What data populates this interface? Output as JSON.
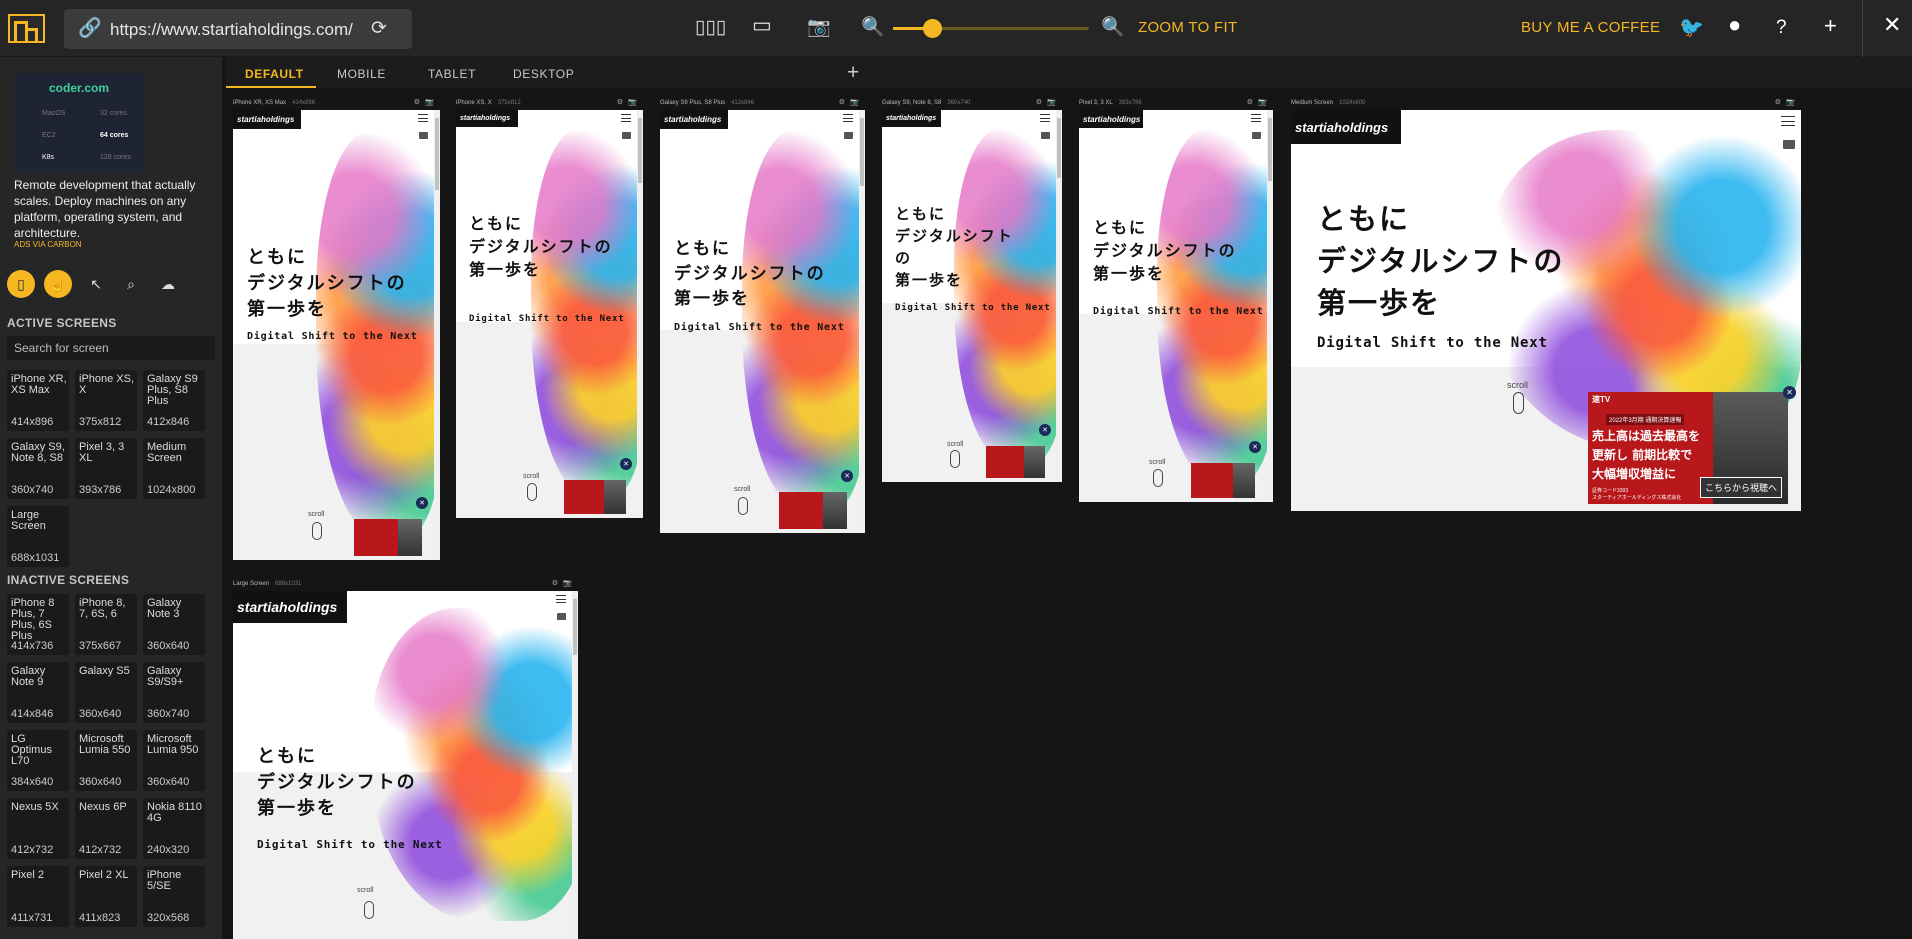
{
  "toolbar": {
    "url": "https://www.startiaholdings.com/",
    "zoom_to_fit": "ZOOM TO FIT",
    "buy_coffee": "BUY ME A COFFEE",
    "zoom_level": 0.2,
    "accent": "#f5b822"
  },
  "sidebar": {
    "ad": {
      "brand": "coder.com",
      "cells": [
        "MacOS",
        "32 cores",
        "EC2",
        "64 cores",
        "K8s",
        "128 cores"
      ],
      "text": "Remote development that actually scales. Deploy machines on any platform, operating system, and architecture.",
      "via": "ADS VIA CARBON"
    },
    "active_title": "ACTIVE SCREENS",
    "search_placeholder": "Search for screen",
    "active_screens": [
      {
        "name": "iPhone XR, XS Max",
        "size": "414x896"
      },
      {
        "name": "iPhone XS, X",
        "size": "375x812"
      },
      {
        "name": "Galaxy S9 Plus, S8 Plus",
        "size": "412x846"
      },
      {
        "name": "Galaxy S9, Note 8, S8",
        "size": "360x740"
      },
      {
        "name": "Pixel 3, 3 XL",
        "size": "393x786"
      },
      {
        "name": "Medium Screen",
        "size": "1024x800"
      },
      {
        "name": "Large Screen",
        "size": "688x1031"
      }
    ],
    "inactive_title": "INACTIVE SCREENS",
    "inactive_screens": [
      {
        "name": "iPhone 8 Plus, 7 Plus, 6S Plus",
        "size": "414x736"
      },
      {
        "name": "iPhone 8, 7, 6S, 6",
        "size": "375x667"
      },
      {
        "name": "Galaxy Note 3",
        "size": "360x640"
      },
      {
        "name": "Galaxy Note 9",
        "size": "414x846"
      },
      {
        "name": "Galaxy S5",
        "size": "360x640"
      },
      {
        "name": "Galaxy S9/S9+",
        "size": "360x740"
      },
      {
        "name": "LG Optimus L70",
        "size": "384x640"
      },
      {
        "name": "Microsoft Lumia 550",
        "size": "360x640"
      },
      {
        "name": "Microsoft Lumia 950",
        "size": "360x640"
      },
      {
        "name": "Nexus 5X",
        "size": "412x732"
      },
      {
        "name": "Nexus 6P",
        "size": "412x732"
      },
      {
        "name": "Nokia 8110 4G",
        "size": "240x320"
      },
      {
        "name": "Pixel 2",
        "size": "411x731"
      },
      {
        "name": "Pixel 2 XL",
        "size": "411x823"
      },
      {
        "name": "iPhone 5/SE",
        "size": "320x568"
      }
    ]
  },
  "tabs": [
    "DEFAULT",
    "MOBILE",
    "TABLET",
    "DESKTOP"
  ],
  "site": {
    "logo": "startiaholdings",
    "headline_1": "ともに",
    "headline_2": "デジタルシフトの",
    "headline_3": "第一歩を",
    "headline_2a": "デジタルシフト",
    "headline_2b": "の",
    "tagline": "Digital Shift to the Next",
    "scroll": "scroll",
    "banner_label": "速TV",
    "banner_sub": "2022年3月期 通期決算速報",
    "banner_line1": "売上高は過去最高を",
    "banner_line2": "更新し 前期比較で",
    "banner_line3": "大幅増収増益に",
    "banner_small1": "証券コード3393",
    "banner_small2": "スターティアホールディングス株式会社",
    "banner_cta": "こちらから視聴へ"
  }
}
